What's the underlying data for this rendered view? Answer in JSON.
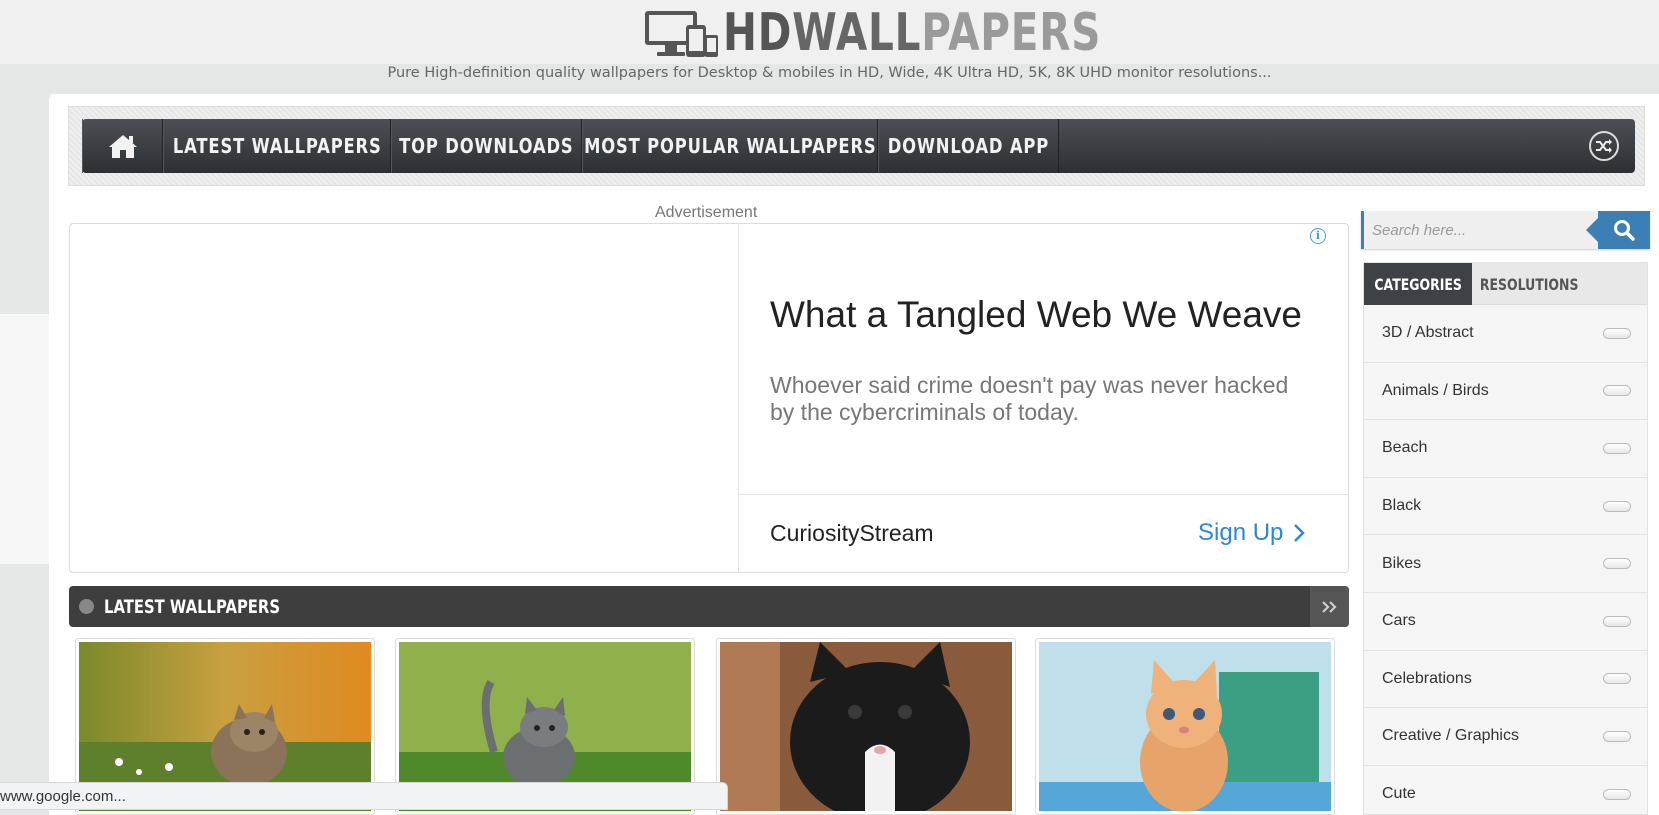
{
  "header": {
    "logo_hd": "HD",
    "logo_wall": "WALL",
    "logo_papers": "PAPERS",
    "tagline": "Pure High-definition quality wallpapers for Desktop & mobiles in HD, Wide, 4K Ultra HD, 5K, 8K UHD monitor resolutions..."
  },
  "nav": {
    "items": [
      {
        "label": "LATEST WALLPAPERS"
      },
      {
        "label": "TOP DOWNLOADS"
      },
      {
        "label": "MOST POPULAR WALLPAPERS"
      },
      {
        "label": "DOWNLOAD APP"
      }
    ],
    "icons": {
      "home": "home-icon",
      "shuffle": "shuffle-icon"
    }
  },
  "ad": {
    "label": "Advertisement",
    "title": "What a Tangled Web We Weave",
    "description": "Whoever said crime doesn't pay was never hacked by the cybercriminals of today.",
    "brand": "CuriosityStream",
    "cta": "Sign Up"
  },
  "latest": {
    "title": "LATEST WALLPAPERS"
  },
  "status_bar": {
    "text": "www.google.com..."
  },
  "sidebar": {
    "search_placeholder": "Search here...",
    "tabs": [
      {
        "label": "CATEGORIES",
        "active": true
      },
      {
        "label": "RESOLUTIONS",
        "active": false
      }
    ],
    "categories": [
      "3D / Abstract",
      "Animals / Birds",
      "Beach",
      "Black",
      "Bikes",
      "Cars",
      "Celebrations",
      "Creative / Graphics",
      "Cute"
    ]
  },
  "colors": {
    "accent_blue": "#3d7eb5",
    "nav_dark": "#2c2f33",
    "link_blue": "#2b88d9"
  }
}
